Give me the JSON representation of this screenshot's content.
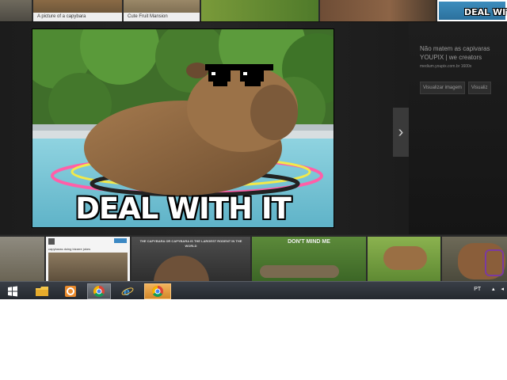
{
  "top_strip": {
    "captions": [
      "A picture of a capybara",
      "Cute Fruit Mansion"
    ],
    "selected_meme_text": "DEAL WIT"
  },
  "viewer": {
    "meme_text": "DEAL WITH IT",
    "next_arrow": "›",
    "info": {
      "title_line1": "Não matem as capivaras",
      "title_line2": "YOUPIX | we creators",
      "url": "medium.youpix.com.br",
      "size": "1600x",
      "buttons": [
        "Visualizar imagem",
        "Visualiz"
      ]
    }
  },
  "bottom_strip": {
    "tweet_text": "capybaras doing bizarre jokes",
    "banner_text": "THE CAPYBARA OR CAPYBARA IS THE LARGEST RODENT IN THE WORLD",
    "mind_text": "DON'T MIND ME"
  },
  "taskbar": {
    "apps": [
      "start",
      "file-explorer",
      "outlook",
      "chrome",
      "internet-explorer",
      "chrome-app"
    ],
    "tray_label": "PT"
  },
  "colors": {
    "viewer_bg": "#1e1e1e",
    "taskbar_bg": "#2d3137",
    "active_highlight": "#f3b35c"
  }
}
